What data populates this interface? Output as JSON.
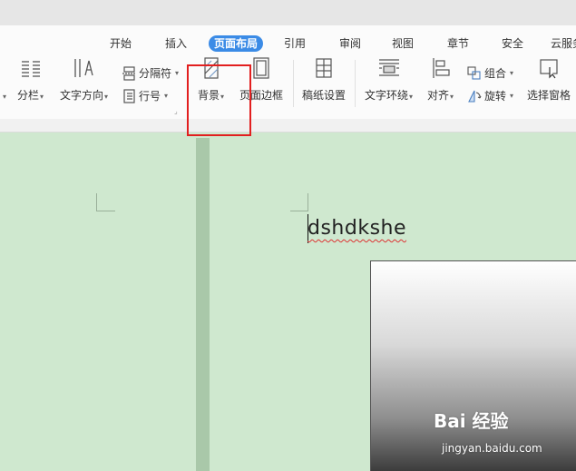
{
  "tabs": [
    "开始",
    "插入",
    "页面布局",
    "引用",
    "审阅",
    "视图",
    "章节",
    "安全",
    "云服务"
  ],
  "active_tab": "页面布局",
  "ribbon": {
    "columns_label": "分栏",
    "text_direction_label": "文字方向",
    "separator_label": "分隔符",
    "line_number_label": "行号",
    "background_label": "背景",
    "page_border_label": "页面边框",
    "manuscript_label": "稿纸设置",
    "text_wrap_label": "文字环绕",
    "align_label": "对齐",
    "group_label": "组合",
    "rotate_label": "旋转",
    "selection_pane_label": "选择窗格"
  },
  "document": {
    "text": "dshdkshe"
  },
  "watermark": {
    "brand": "Bai 经验",
    "url": "jingyan.baidu.com"
  },
  "colors": {
    "accent": "#3b8be6",
    "highlight": "#e21f1f",
    "doc_bg": "#cfe8cf"
  },
  "icons": {
    "columns": "columns-icon",
    "text_direction": "text-direction-icon",
    "separator": "separator-icon",
    "line_number": "line-number-icon",
    "background": "background-icon",
    "page_border": "page-border-icon",
    "manuscript": "manuscript-icon",
    "text_wrap": "text-wrap-icon",
    "align": "align-icon",
    "group": "group-icon",
    "rotate": "rotate-icon",
    "selection_pane": "selection-pane-icon"
  }
}
